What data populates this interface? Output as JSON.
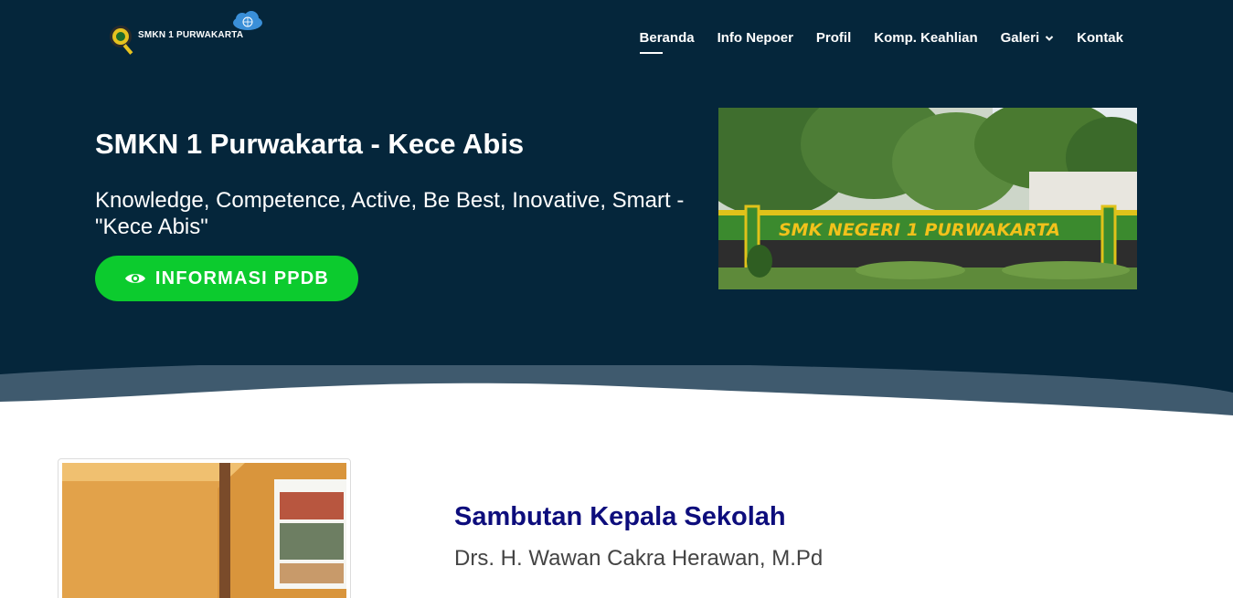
{
  "header": {
    "logo_text": "SMKN 1 PURWAKARTA",
    "nav": [
      {
        "label": "Beranda"
      },
      {
        "label": "Info Nepoer"
      },
      {
        "label": "Profil"
      },
      {
        "label": "Komp. Keahlian"
      },
      {
        "label": "Galeri"
      },
      {
        "label": "Kontak"
      }
    ]
  },
  "hero": {
    "title": "SMKN 1 Purwakarta - Kece Abis",
    "subtitle": "Knowledge, Competence, Active, Be Best, Inovative, Smart - \"Kece Abis\"",
    "cta_label": "INFORMASI PPDB",
    "cta_icon": "eye-icon",
    "photo_sign_text": "SMK NEGERI 1 PURWAKARTA"
  },
  "welcome": {
    "title": "Sambutan Kepala Sekolah",
    "name": "Drs. H. Wawan Cakra Herawan, M.Pd"
  },
  "colors": {
    "hero_bg": "#05263b",
    "wave": "#3f5a6e",
    "cta": "#0ccb2e",
    "section_title": "#0d0d7c"
  }
}
